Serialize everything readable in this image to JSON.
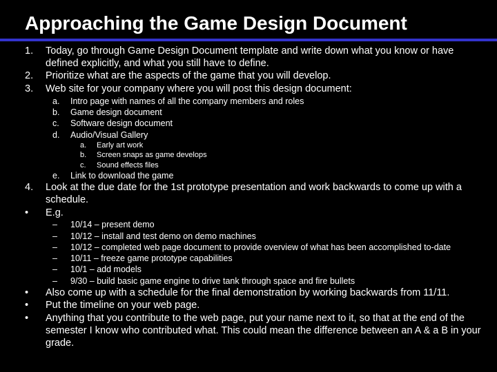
{
  "title": "Approaching the Game Design Document",
  "items": [
    {
      "level": 1,
      "marker": "1.",
      "text": "Today, go through Game Design Document template and write down what you know or have defined explicitly, and what you still have to define."
    },
    {
      "level": 1,
      "marker": "2.",
      "text": "Prioritize what are the aspects of the game that you will develop."
    },
    {
      "level": 1,
      "marker": "3.",
      "text": "Web site for your company where you will post this design document:"
    },
    {
      "level": 2,
      "marker": "a.",
      "text": "Intro page with names of all the company members and roles"
    },
    {
      "level": 2,
      "marker": "b.",
      "text": "Game design document"
    },
    {
      "level": 2,
      "marker": "c.",
      "text": "Software design document"
    },
    {
      "level": 2,
      "marker": "d.",
      "text": "Audio/Visual Gallery"
    },
    {
      "level": 3,
      "marker": "a.",
      "text": "Early art work"
    },
    {
      "level": 3,
      "marker": "b.",
      "text": "Screen snaps as game develops"
    },
    {
      "level": 3,
      "marker": "c.",
      "text": "Sound effects files"
    },
    {
      "level": 2,
      "marker": "e.",
      "text": "Link to download the game"
    },
    {
      "level": 1,
      "marker": "4.",
      "text": "Look at the due date for the 1st prototype presentation and work backwards to come up with a schedule."
    },
    {
      "level": 1,
      "marker": "•",
      "text": "E.g."
    },
    {
      "level": 2,
      "marker": "–",
      "text": "10/14 – present demo"
    },
    {
      "level": 2,
      "marker": "–",
      "text": "10/12 – install and test demo on demo machines"
    },
    {
      "level": 2,
      "marker": "–",
      "text": "10/12 – completed web page document to provide overview of what has been accomplished to-date"
    },
    {
      "level": 2,
      "marker": "–",
      "text": "10/11 – freeze game prototype capabilities"
    },
    {
      "level": 2,
      "marker": "–",
      "text": "10/1 – add models"
    },
    {
      "level": 2,
      "marker": "–",
      "text": "9/30 – build basic game engine to drive tank through space and fire bullets"
    },
    {
      "level": 1,
      "marker": "•",
      "text": "Also come up with a schedule for the final demonstration by working backwards from 11/11."
    },
    {
      "level": 1,
      "marker": "•",
      "text": "Put the timeline on your web page."
    },
    {
      "level": 1,
      "marker": "•",
      "text": "Anything that you contribute to the web page, put your name next to it, so that at the end of the semester I know who contributed what. This could mean the difference between an A & a B in your grade."
    }
  ]
}
